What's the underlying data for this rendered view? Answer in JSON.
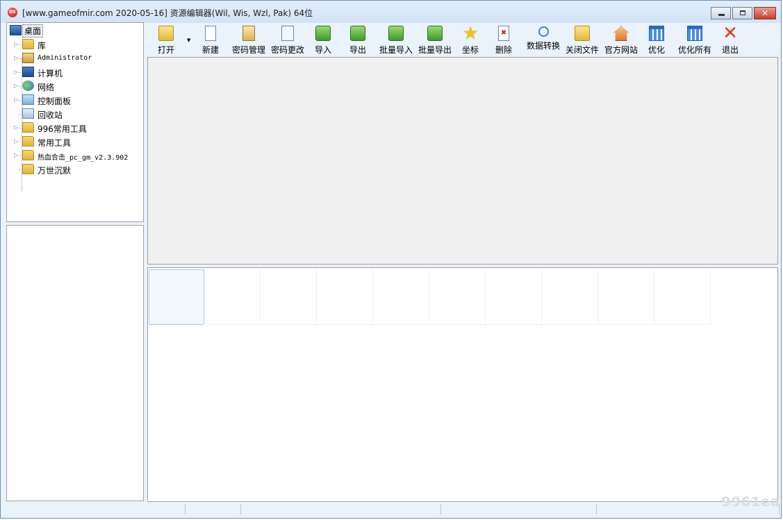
{
  "window": {
    "title": "[www.gameofmir.com 2020-05-16] 资源编辑器(Wil, Wis, Wzl, Pak)  64位",
    "app_icon_text": "DX",
    "buttons": {
      "minimize": "minimize",
      "maximize": "maximize",
      "close": "✕"
    }
  },
  "tree": {
    "root": {
      "label": "桌面",
      "icon": "desktop-icon"
    },
    "items": [
      {
        "label": "库",
        "icon": "library-folder-icon",
        "expandable": true
      },
      {
        "label": "Administrator",
        "icon": "user-folder-icon",
        "expandable": true
      },
      {
        "label": "计算机",
        "icon": "computer-icon",
        "expandable": true
      },
      {
        "label": "网络",
        "icon": "network-icon",
        "expandable": true
      },
      {
        "label": "控制面板",
        "icon": "control-panel-icon",
        "expandable": true
      },
      {
        "label": "回收站",
        "icon": "recycle-bin-icon",
        "expandable": false
      },
      {
        "label": "996常用工具",
        "icon": "folder-icon",
        "expandable": true
      },
      {
        "label": "常用工具",
        "icon": "folder-icon",
        "expandable": true
      },
      {
        "label": "热血合击_pc_gm_v2.3.902",
        "icon": "folder-icon",
        "expandable": true
      },
      {
        "label": "万世沉默",
        "icon": "folder-icon",
        "expandable": false
      }
    ]
  },
  "toolbar": [
    {
      "label": "打开",
      "icon": "open-folder-icon",
      "has_dropdown": true
    },
    {
      "label": "新建",
      "icon": "new-document-icon"
    },
    {
      "label": "密码管理",
      "icon": "clipboard-icon"
    },
    {
      "label": "密码更改",
      "icon": "documents-icon"
    },
    {
      "label": "导入",
      "icon": "import-icon"
    },
    {
      "label": "导出",
      "icon": "export-icon"
    },
    {
      "label": "批量导入",
      "icon": "batch-import-icon"
    },
    {
      "label": "批量导出",
      "icon": "batch-export-icon"
    },
    {
      "label": "坐标",
      "icon": "star-icon"
    },
    {
      "label": "删除",
      "icon": "delete-icon"
    },
    {
      "label": "数据转换",
      "icon": "magnifier-icon"
    },
    {
      "label": "关闭文件",
      "icon": "close-file-icon"
    },
    {
      "label": "官方网站",
      "icon": "home-icon"
    },
    {
      "label": "优化",
      "icon": "grid-icon"
    },
    {
      "label": "优化所有",
      "icon": "grid-all-icon"
    },
    {
      "label": "退出",
      "icon": "exit-x-icon"
    }
  ],
  "thumbnails": {
    "count": 10,
    "selected_index": 0
  },
  "statusbar": [
    "",
    "",
    "",
    "",
    "",
    ""
  ],
  "watermark": "9961ea"
}
